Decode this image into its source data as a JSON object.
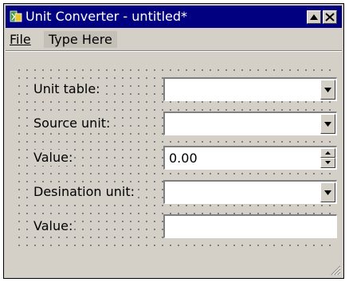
{
  "window": {
    "title": "Unit Converter - untitled*",
    "titlebar_color": "#000080",
    "icon": "app-icon",
    "buttons": [
      "maximize-icon",
      "close-icon"
    ]
  },
  "menubar": {
    "items": [
      {
        "label": "File",
        "underline_char": "F"
      },
      {
        "label": "Type Here"
      }
    ]
  },
  "form": {
    "unit_table": {
      "label": "Unit table:",
      "value": ""
    },
    "source_unit": {
      "label": "Source unit:",
      "value": ""
    },
    "value_input": {
      "label": "Value:",
      "value": "0.00"
    },
    "destination_unit": {
      "label": "Desination unit:",
      "value": ""
    },
    "value_output": {
      "label": "Value:",
      "value": ""
    }
  },
  "colors": {
    "window_bg": "#d4d0c8",
    "field_bg": "#ffffff"
  }
}
